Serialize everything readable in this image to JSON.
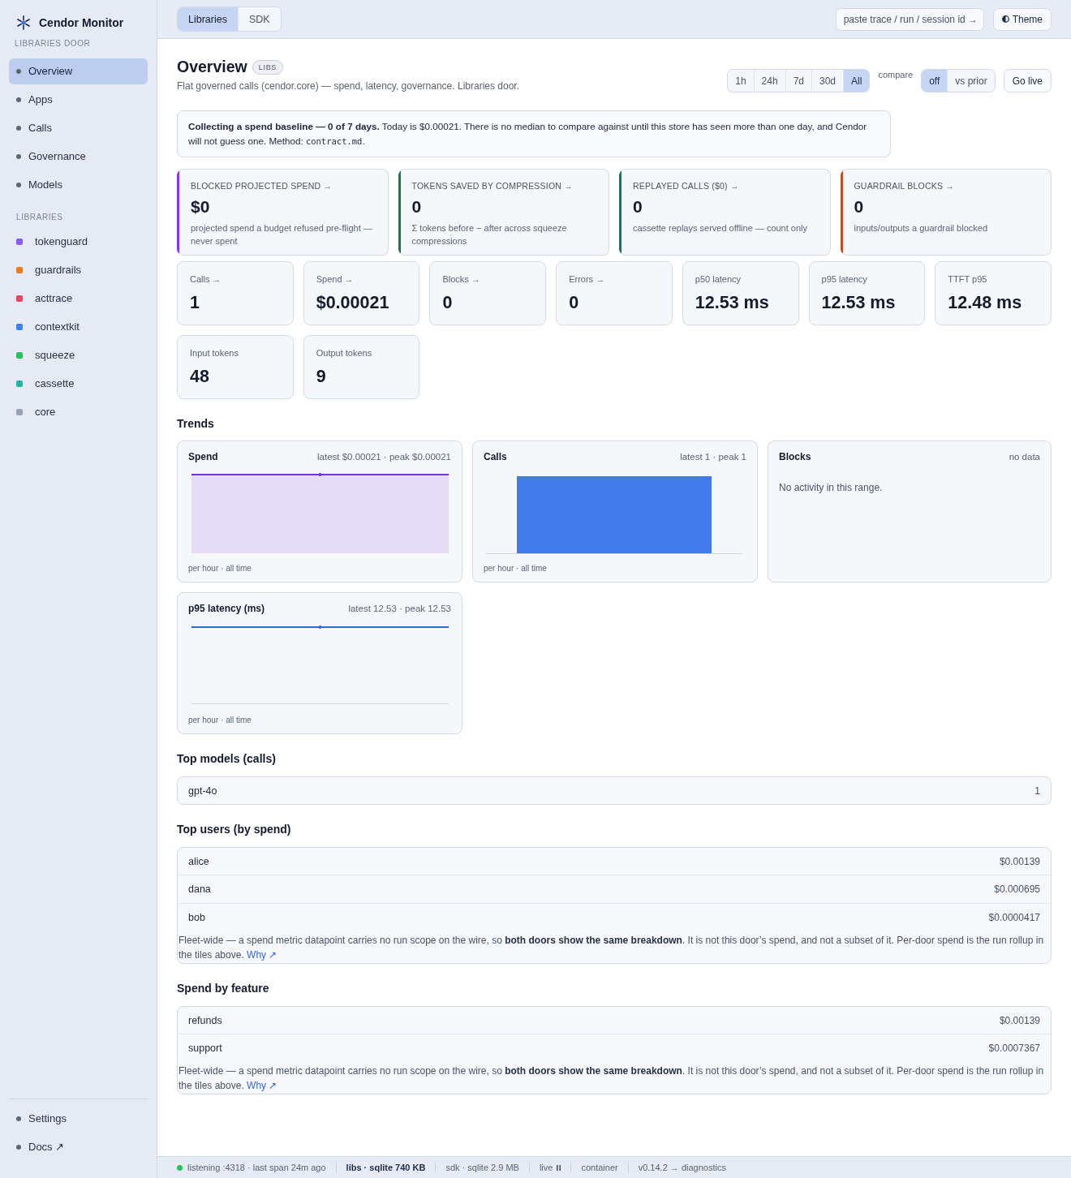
{
  "sidebar": {
    "brand": "Cendor Monitor",
    "door_label": "LIBRARIES DOOR",
    "nav": [
      {
        "label": "Overview",
        "selected": true
      },
      {
        "label": "Apps",
        "selected": false
      },
      {
        "label": "Calls",
        "selected": false
      },
      {
        "label": "Governance",
        "selected": false
      },
      {
        "label": "Models",
        "selected": false
      }
    ],
    "libraries_heading": "LIBRARIES",
    "libraries": [
      {
        "label": "tokenguard",
        "color": "#8b5cf6"
      },
      {
        "label": "guardrails",
        "color": "#f07a1f"
      },
      {
        "label": "acttrace",
        "color": "#e84560"
      },
      {
        "label": "contextkit",
        "color": "#3b7ff0"
      },
      {
        "label": "squeeze",
        "color": "#2fbf5a"
      },
      {
        "label": "cassette",
        "color": "#1fb8a0"
      },
      {
        "label": "core",
        "color": "#9aa3b5"
      }
    ],
    "footer": [
      {
        "label": "Settings",
        "selected": false
      },
      {
        "label": "Docs ↗",
        "selected": false
      }
    ]
  },
  "topbar": {
    "doors": [
      {
        "label": "Libraries",
        "selected": true
      },
      {
        "label": "SDK",
        "selected": false
      }
    ],
    "trace_search": {
      "placeholder": "paste trace / run / session id →"
    },
    "theme_button": "Theme"
  },
  "header": {
    "title": "Overview",
    "badge": "LIBS",
    "subtitle": "Flat governed calls (cendor.core) — spend, latency, governance. Libraries door.",
    "ranges": [
      {
        "label": "1h",
        "selected": false
      },
      {
        "label": "24h",
        "selected": false
      },
      {
        "label": "7d",
        "selected": false
      },
      {
        "label": "30d",
        "selected": false
      },
      {
        "label": "All",
        "selected": true
      }
    ],
    "compare_label": "compare",
    "compare": [
      {
        "label": "off",
        "selected": true
      },
      {
        "label": "vs prior",
        "selected": false
      }
    ],
    "live_button": "Go live"
  },
  "notice": {
    "segments": [
      {
        "kind": "text",
        "text": "**Collecting a spend baseline — 0 of 7 days.** Today is $0.00021. There is no median to compare against until this store has seen more than one day, and Cendor will not guess one. Method: "
      },
      {
        "kind": "code",
        "text": "contract.md"
      },
      {
        "kind": "text",
        "text": "."
      }
    ]
  },
  "highlights": [
    {
      "label": "BLOCKED PROJECTED SPEND →",
      "value": "$0",
      "description": "projected spend a budget refused pre-flight — never spent",
      "color": "#7c3aed"
    },
    {
      "label": "TOKENS SAVED BY COMPRESSION →",
      "value": "0",
      "description": "Σ tokens before − after across squeeze compressions",
      "color": "#157a46"
    },
    {
      "label": "REPLAYED CALLS ($0) →",
      "value": "0",
      "description": "cassette replays served offline — count only",
      "color": "#0e7a5c"
    },
    {
      "label": "GUARDRAIL BLOCKS →",
      "value": "0",
      "description": "inputs/outputs a guardrail blocked",
      "color": "#c84b1c"
    }
  ],
  "stats": [
    {
      "label": "Calls →",
      "value": "1"
    },
    {
      "label": "Spend →",
      "value": "$0.00021"
    },
    {
      "label": "Blocks →",
      "value": "0"
    },
    {
      "label": "Errors →",
      "value": "0"
    },
    {
      "label": "p50 latency",
      "value": "12.53 ms"
    },
    {
      "label": "p95 latency",
      "value": "12.53 ms"
    },
    {
      "label": "TTFT p95",
      "value": "12.48 ms"
    },
    {
      "label": "Input tokens",
      "value": "48"
    },
    {
      "label": "Output tokens",
      "value": "9"
    }
  ],
  "trends": {
    "title": "Trends",
    "cards": [
      {
        "title": "Spend",
        "summary": "latest $0.00021 · peak $0.00021",
        "kind": "area",
        "footnote": "per hour · all time"
      },
      {
        "title": "Calls",
        "summary": "latest 1 · peak 1",
        "kind": "bar",
        "footnote": "per hour · all time"
      },
      {
        "title": "Blocks",
        "summary": "no data",
        "kind": "empty",
        "message": "No activity in this range."
      },
      {
        "title": "p95 latency (ms)",
        "summary": "latest 12.53 · peak 12.53",
        "kind": "line",
        "footnote": "per hour · all time"
      }
    ]
  },
  "sections": [
    {
      "title": "Top models (calls)",
      "rows": [
        {
          "name": "gpt-4o",
          "value": "1"
        }
      ]
    },
    {
      "title": "Top users (by spend)",
      "rows": [
        {
          "name": "alice",
          "value": "$0.00139"
        },
        {
          "name": "dana",
          "value": "$0.000695"
        },
        {
          "name": "bob",
          "value": "$0.0000417"
        }
      ],
      "note": {
        "text": "Fleet-wide — a spend metric datapoint carries no run scope on the wire, so **both doors show the same breakdown**. It is not this door’s spend, and not a subset of it. Per-door spend is the run rollup in the tiles above.",
        "link": "Why ↗"
      }
    },
    {
      "title": "Spend by feature",
      "rows": [
        {
          "name": "refunds",
          "value": "$0.00139"
        },
        {
          "name": "support",
          "value": "$0.0007367"
        }
      ],
      "note": {
        "text": "Fleet-wide — a spend metric datapoint carries no run scope on the wire, so **both doors show the same breakdown**. It is not this door’s spend, and not a subset of it. Per-door spend is the run rollup in the tiles above.",
        "link": "Why ↗"
      }
    }
  ],
  "status_bar": {
    "listener": {
      "text": "listening :4318 · last span 24m ago",
      "online": true
    },
    "stores": [
      {
        "label": "libs · sqlite 740 KB",
        "selected": true
      },
      {
        "label": "sdk · sqlite 2.9 MB",
        "selected": false
      }
    ],
    "live": {
      "label": "live",
      "paused": true
    },
    "runtime": "container",
    "version": "v0.14.2 → diagnostics"
  }
}
